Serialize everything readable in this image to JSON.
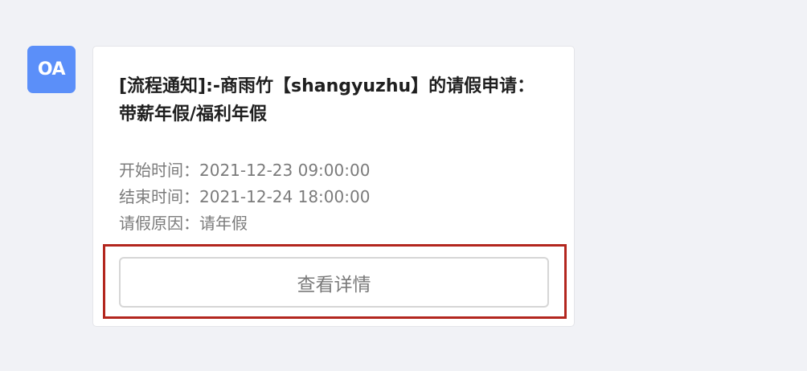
{
  "avatar": {
    "label": "OA",
    "color": "#5b8ff9"
  },
  "card": {
    "title": "[流程通知]:-商雨竹【shangyuzhu】的请假申请：带薪年假/福利年假",
    "fields": [
      {
        "label": "开始时间：",
        "value": "2021-12-23 09:00:00"
      },
      {
        "label": "结束时间：",
        "value": "2021-12-24 18:00:00"
      },
      {
        "label": "请假原因：",
        "value": "请年假"
      }
    ],
    "button_label": "查看详情"
  },
  "highlight": {
    "color": "#b3261e"
  }
}
